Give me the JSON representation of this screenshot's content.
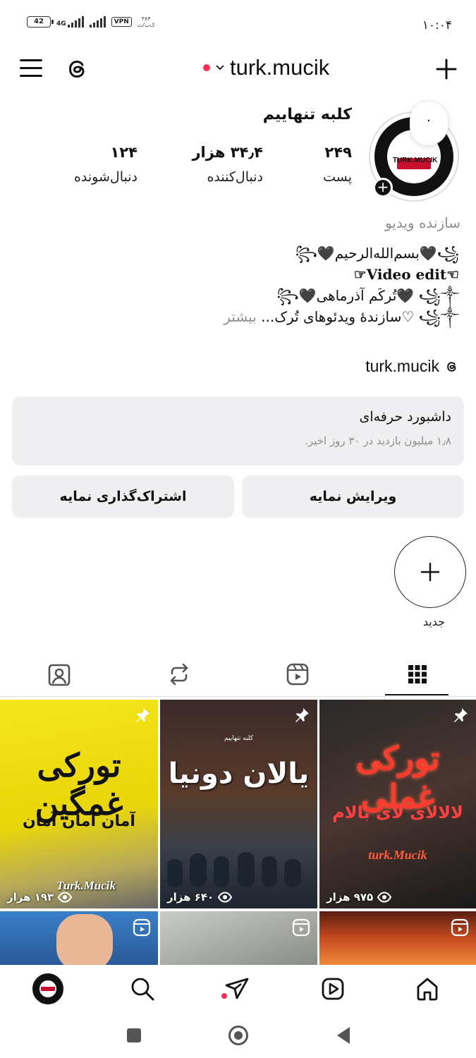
{
  "status_bar": {
    "time": "۱۰:۰۴",
    "battery": "42",
    "network": "4G",
    "vpn": "VPN",
    "speed_value": "۳۸۴",
    "speed_unit": "ک‌ب/ث"
  },
  "header": {
    "username": "turk.mucik"
  },
  "profile": {
    "display_name": "کلبه تنهاییم",
    "note": "۰",
    "avatar_text": "TURK.MUCIK",
    "stats": {
      "posts_count": "۲۴۹",
      "posts_label": "پست",
      "followers_count": "۳۴٫۴ هزار",
      "followers_label": "دنبال‌کننده",
      "following_count": "۱۲۴",
      "following_label": "دنبال‌شونده"
    },
    "category": "سازنده ویدیو",
    "bio_lines": [
      "꧁🖤بسم‌الله‌الرحیم🖤꧂",
      "☜Video edit☞",
      "꧁༒ 🖤تُرکَم آذرماهی🖤꧂",
      "꧁༒ ♡سازندهٔ ویدئوهای تُرک..."
    ],
    "bio_more": "بیشتر",
    "threads_handle": "turk.mucik"
  },
  "dashboard": {
    "title": "داشبورد حرفه‌ای",
    "subtitle": "۱٫۸ میلیون بازدید در ۳۰ روز اخیر."
  },
  "buttons": {
    "edit_profile": "ویرایش نمایه",
    "share_profile": "اشتراک‌گذاری نمایه"
  },
  "highlights": {
    "new_label": "جدید"
  },
  "tabs": [
    "grid",
    "reels",
    "reposts",
    "tagged"
  ],
  "grid": [
    {
      "title": "تورکی غملی",
      "subtitle": "لالالای لای بالام",
      "brand": "turk.Mucik",
      "views": "۹۷۵ هزار",
      "pinned": true
    },
    {
      "title": "یالان دونیا",
      "top_text": "کلبه تنهاییم",
      "views": "۶۴۰ هزار",
      "pinned": true
    },
    {
      "title": "تورکی غمگین",
      "subtitle": "آمان آمان آمان",
      "brand": "Turk.Mucik",
      "views": "۱۹۳ هزار",
      "pinned": true
    },
    {
      "type": "reel"
    },
    {
      "type": "reel"
    },
    {
      "type": "reel"
    }
  ],
  "colors": {
    "accent_red": "#ff2d55",
    "button_bg": "#efeff2",
    "muted_text": "#8e8e8e"
  }
}
